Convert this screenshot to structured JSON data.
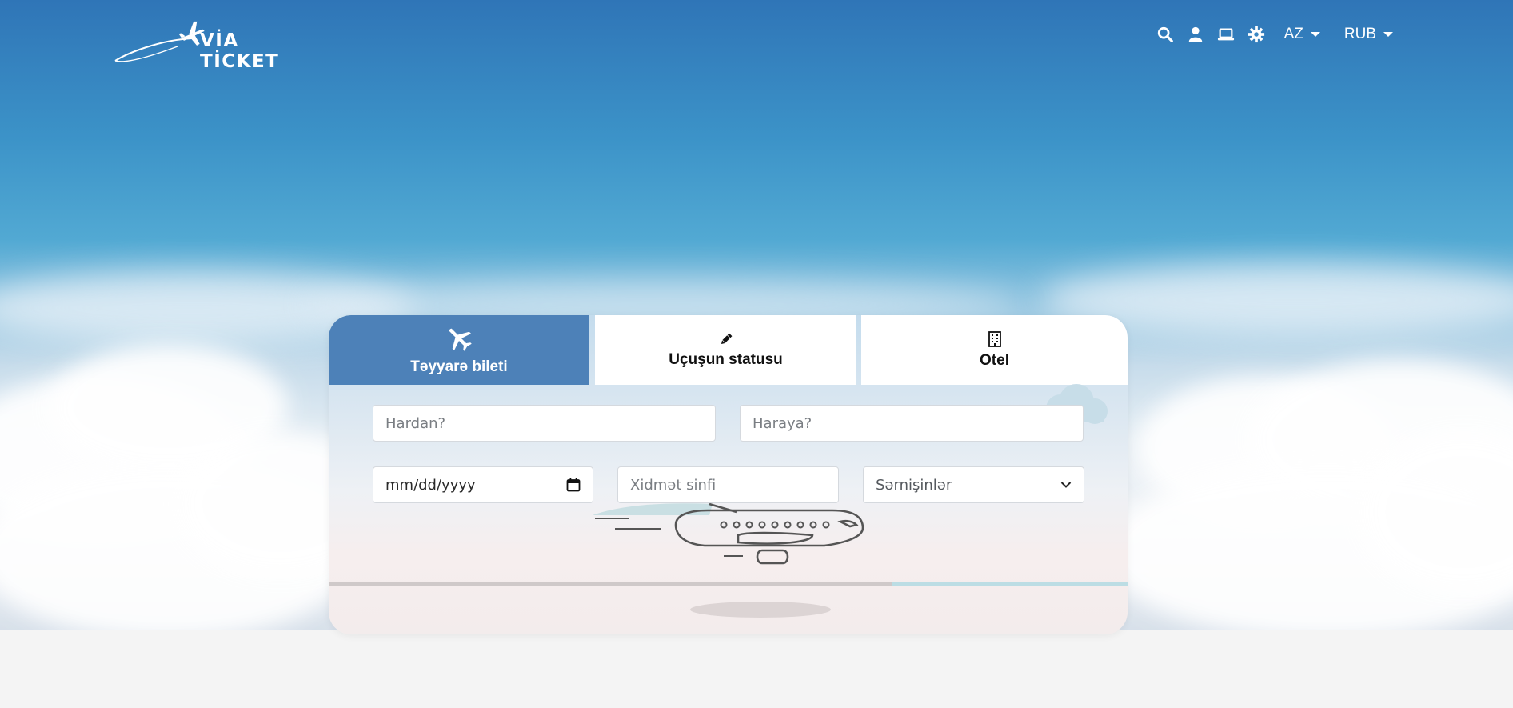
{
  "header": {
    "logo_text": "VİA TİCKET",
    "icons": [
      "search-icon",
      "user-icon",
      "laptop-icon",
      "gear-icon"
    ],
    "language": "AZ",
    "currency": "RUB"
  },
  "tabs": [
    {
      "label": "Təyyarə bileti",
      "icon": "plane-icon",
      "active": true
    },
    {
      "label": "Uçuşun statusu",
      "icon": "pencil-icon",
      "active": false
    },
    {
      "label": "Otel",
      "icon": "building-icon",
      "active": false
    }
  ],
  "form": {
    "from_placeholder": "Hardan?",
    "to_placeholder": "Haraya?",
    "date_placeholder": "mm/dd/yyyy",
    "class_placeholder": "Xidmət sinfi",
    "passengers_label": "Sərnişinlər"
  },
  "colors": {
    "active_tab": "#4d81b8",
    "sky_top": "#2f75b7",
    "page_bg": "#f4f4f4"
  }
}
